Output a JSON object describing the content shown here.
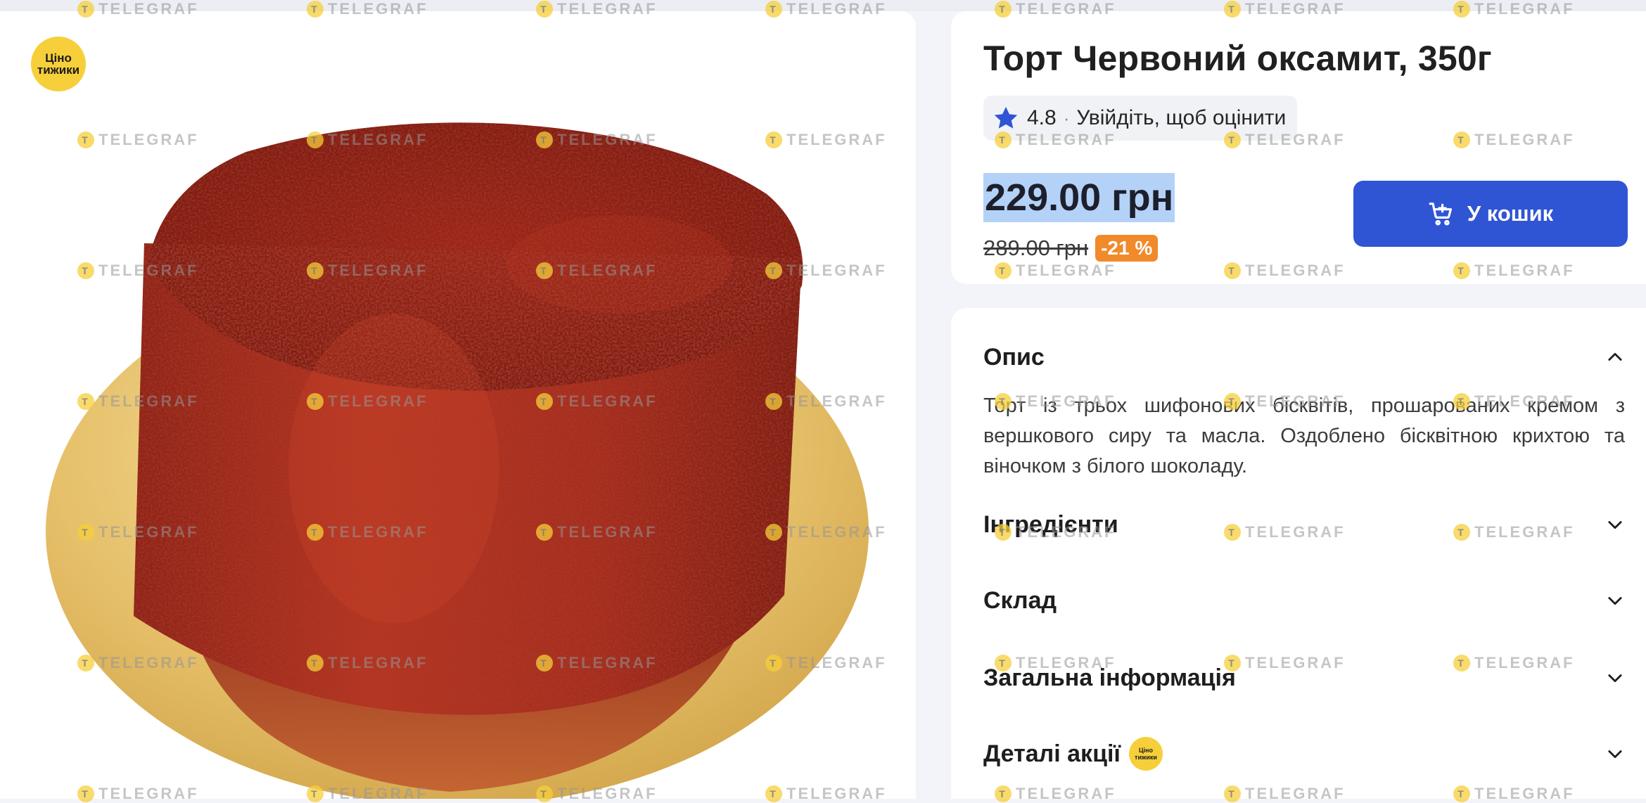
{
  "promo_badge": {
    "line1": "Ціно",
    "line2": "тижики"
  },
  "product": {
    "title": "Торт Червоний оксамит, 350г",
    "rating": "4.8",
    "rating_separator": "·",
    "rate_prompt": "Увійдіть, щоб оцінити",
    "price_current": "229.00 грн",
    "price_old": "289.00 грн",
    "discount": "-21 %",
    "add_to_cart_label": "У кошик"
  },
  "details": {
    "sections": [
      {
        "title": "Опис",
        "expanded": true
      },
      {
        "title": "Інгредієнти",
        "expanded": false
      },
      {
        "title": "Склад",
        "expanded": false
      },
      {
        "title": "Загальна інформація",
        "expanded": false
      },
      {
        "title": "Деталі акції",
        "expanded": false
      }
    ],
    "description": "Торт із трьох шифонових бісквітів, прошарованих кремом з вершкового сиру та масла. Оздоблено бісквітною крихтою та віночком з білого шоколаду."
  },
  "watermark": {
    "text": "TELEGRAF",
    "logo_glyph": "T"
  },
  "colors": {
    "accent": "#2f55d4",
    "discount": "#f08a2b",
    "badge": "#f6cf3a",
    "star": "#2f55d4",
    "price_highlight": "#b4d2f7"
  }
}
